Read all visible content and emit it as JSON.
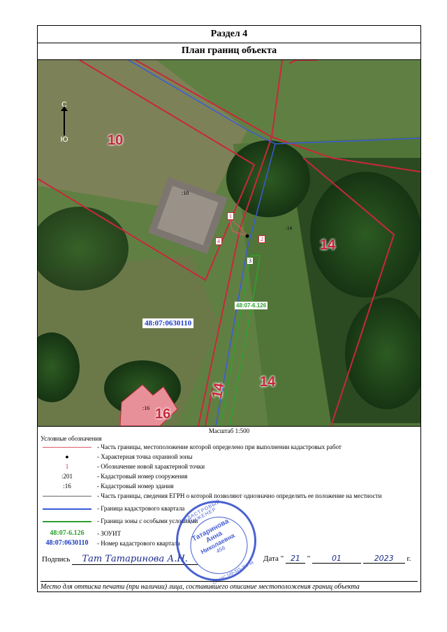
{
  "header": {
    "section": "Раздел 4",
    "title": "План границ объекта"
  },
  "map": {
    "compass_north": "С",
    "compass_south": "Ю",
    "parcel_labels": [
      "10",
      "14",
      "14",
      "14",
      "16"
    ],
    "building_numbers": [
      ":10",
      ":16",
      ":14"
    ],
    "point_numbers": [
      "1",
      "2",
      "3",
      "4"
    ],
    "zone_label": "48:07-6.126",
    "quarter_label": "48:07:0630110"
  },
  "scale": "Масштаб 1:500",
  "legend": {
    "title": "Условные обозначения",
    "items": [
      {
        "symbol": "",
        "text": "- Часть границы, местоположение которой определено при выполнении кадастровых работ"
      },
      {
        "symbol": "●",
        "text": "- Характерная точка охранной зоны"
      },
      {
        "symbol": "1",
        "text": "- Обозначение новой характерной точки"
      },
      {
        "symbol": ":201",
        "text": "- Кадастровый номер сооружения"
      },
      {
        "symbol": ":16",
        "text": "- Кадастровый номер здания"
      },
      {
        "symbol": "",
        "text": "- Часть границы, сведения ЕГРН о которой позволяют однозначно определить ее положение на местности"
      },
      {
        "symbol": "",
        "text": "- Граница кадастрового квартала"
      },
      {
        "symbol": "",
        "text": "- Граница зоны с особыми условиями"
      },
      {
        "symbol": "48:07-6.126",
        "text": "- ЗОУИТ"
      },
      {
        "symbol": "48:07:0630110",
        "text": "- Номер кадастрового квартала"
      }
    ]
  },
  "signature": {
    "label": "Подпись",
    "handwritten": "Тат Татаринова А.Н.",
    "date_label": "Дата",
    "day": "21",
    "month": "01",
    "year": "2023",
    "year_suffix": "г."
  },
  "stamp": {
    "ring_text": "КАДАСТРОВЫЙ ИНЖЕНЕР",
    "name_line1": "Татаринова",
    "name_line2": "Анна",
    "name_line3": "Николаевна",
    "number": "456",
    "snils": "СНИЛС 149-315-355 94"
  },
  "footer": "Место для оттиска печати (при наличии) лица, составившего описание местоположения границ объекта",
  "colors": {
    "parcel": "#c8283a",
    "survey_line": "#e05a6a",
    "quarter": "#3a5bd8",
    "zone": "#2fa02f",
    "quarter_text": "#1c3cc4"
  }
}
